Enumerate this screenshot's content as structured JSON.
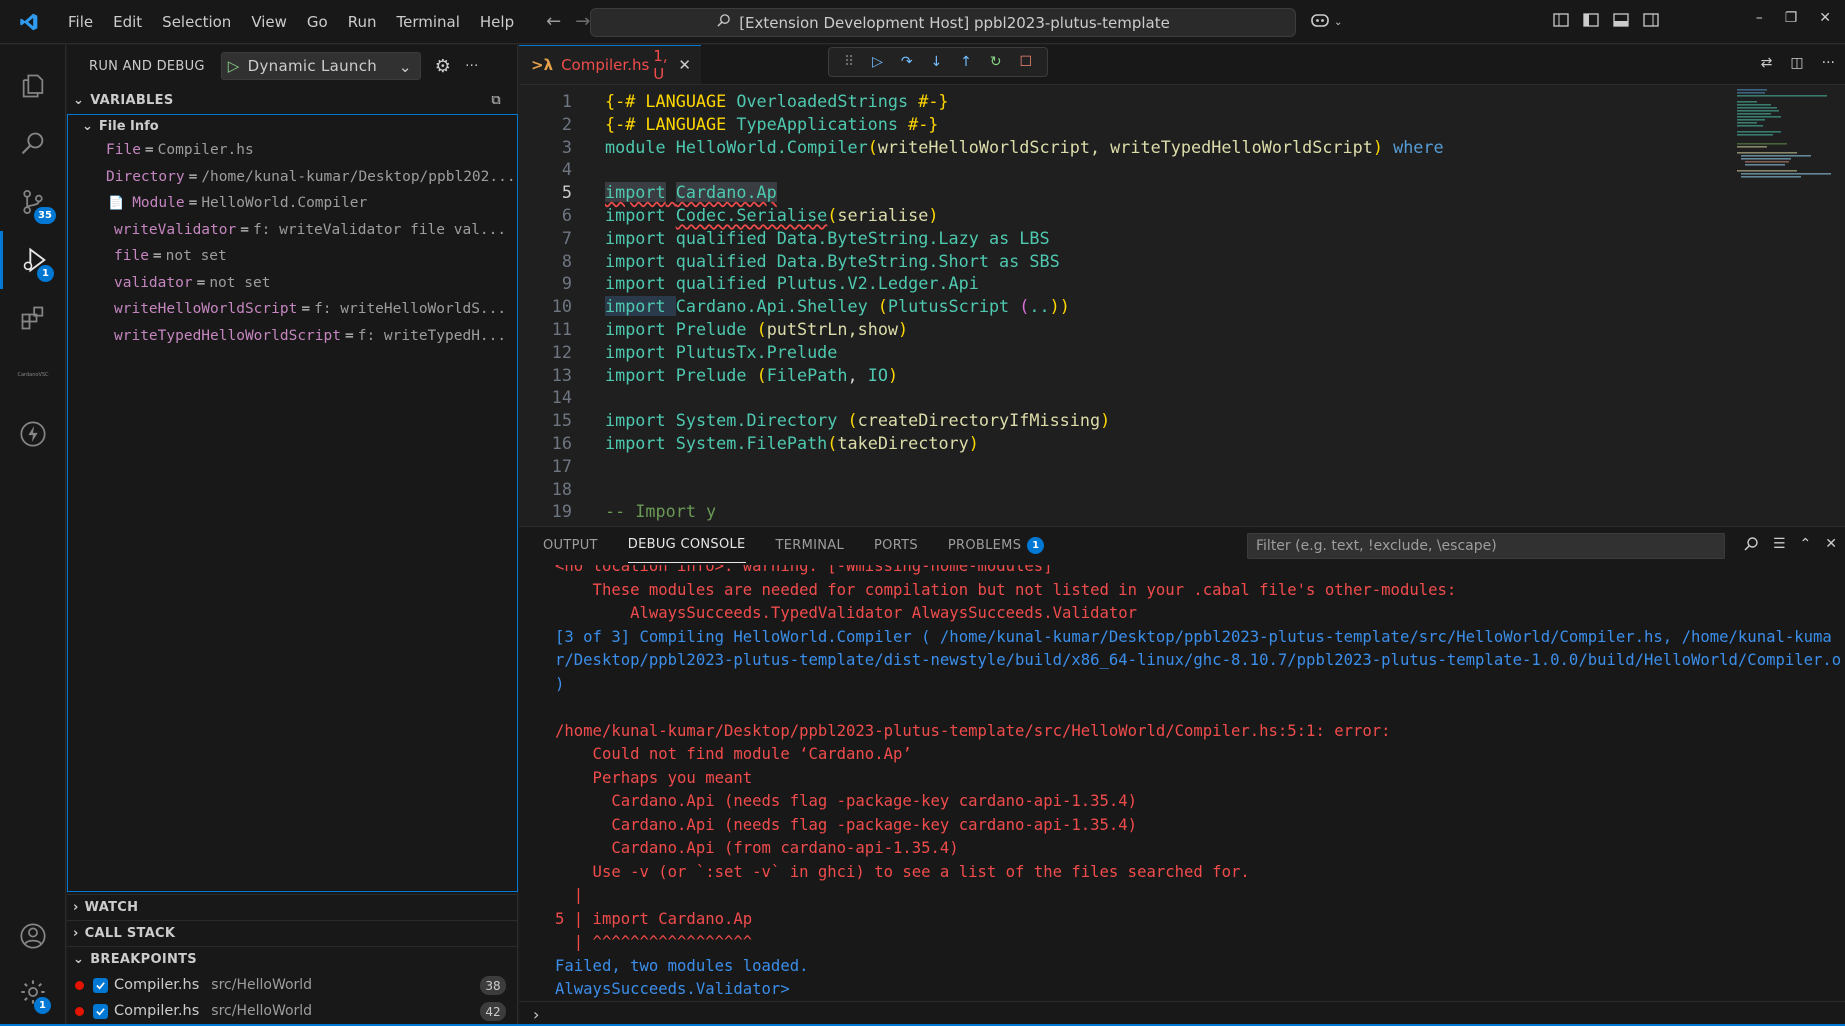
{
  "window": {
    "title": "[Extension Development Host] ppbl2023-plutus-template"
  },
  "menu": [
    "File",
    "Edit",
    "Selection",
    "View",
    "Go",
    "Run",
    "Terminal",
    "Help"
  ],
  "activity": {
    "scm_badge": "35",
    "debug_badge": "1",
    "settings_badge": "1",
    "cardano_label": "CardanoVSC"
  },
  "sidebar": {
    "title": "RUN AND DEBUG",
    "launch_config": "Dynamic Launch",
    "variables_label": "VARIABLES",
    "scope_label": "File Info",
    "variables": [
      {
        "name": "File",
        "value": "Compiler.hs"
      },
      {
        "name": "Directory",
        "value": "/home/kunal-kumar/Desktop/ppbl202..."
      },
      {
        "name": "Module",
        "value": "HelloWorld.Compiler"
      },
      {
        "name": "writeValidator ",
        "value": "f: writeValidator file val..."
      },
      {
        "name": "file ",
        "value": "not set"
      },
      {
        "name": "validator ",
        "value": "not set"
      },
      {
        "name": "writeHelloWorldScript ",
        "value": "f: writeHelloWorldS..."
      },
      {
        "name": "writeTypedHelloWorldScript ",
        "value": "f: writeTypedH..."
      }
    ],
    "watch_label": "WATCH",
    "callstack_label": "CALL STACK",
    "breakpoints_label": "BREAKPOINTS",
    "breakpoints": [
      {
        "file": "Compiler.hs",
        "path": "src/HelloWorld",
        "line": "38"
      },
      {
        "file": "Compiler.hs",
        "path": "src/HelloWorld",
        "line": "42"
      }
    ]
  },
  "editor": {
    "tab_label": "Compiler.hs",
    "tab_status": "1, U",
    "line_numbers": [
      "1",
      "2",
      "3",
      "4",
      "5",
      "6",
      "7",
      "8",
      "9",
      "10",
      "11",
      "12",
      "13",
      "14",
      "15",
      "16",
      "17",
      "18",
      "19"
    ]
  },
  "panel": {
    "tabs": [
      "OUTPUT",
      "DEBUG CONSOLE",
      "TERMINAL",
      "PORTS",
      "PROBLEMS"
    ],
    "problems_badge": "1",
    "filter_placeholder": "Filter (e.g. text, !exclude, \\escape)",
    "console_lines": [
      {
        "text": "<no location info>: warning: [-Wmissing-home-modules]",
        "color": "red"
      },
      {
        "text": "    These modules are needed for compilation but not listed in your .cabal file's other-modules:",
        "color": "red"
      },
      {
        "text": "        AlwaysSucceeds.TypedValidator AlwaysSucceeds.Validator",
        "color": "red"
      },
      {
        "text": "[3 of 3] Compiling HelloWorld.Compiler ( /home/kunal-kumar/Desktop/ppbl2023-plutus-template/src/HelloWorld/Compiler.hs, /home/kunal-kuma",
        "color": "blue"
      },
      {
        "text": "r/Desktop/ppbl2023-plutus-template/dist-newstyle/build/x86_64-linux/ghc-8.10.7/ppbl2023-plutus-template-1.0.0/build/HelloWorld/Compiler.o",
        "color": "blue"
      },
      {
        "text": ")",
        "color": "blue"
      },
      {
        "text": "",
        "color": "red"
      },
      {
        "text": "/home/kunal-kumar/Desktop/ppbl2023-plutus-template/src/HelloWorld/Compiler.hs:5:1: error:",
        "color": "red"
      },
      {
        "text": "    Could not find module ‘Cardano.Ap’",
        "color": "red"
      },
      {
        "text": "    Perhaps you meant",
        "color": "red"
      },
      {
        "text": "      Cardano.Api (needs flag -package-key cardano-api-1.35.4)",
        "color": "red"
      },
      {
        "text": "      Cardano.Api (needs flag -package-key cardano-api-1.35.4)",
        "color": "red"
      },
      {
        "text": "      Cardano.Api (from cardano-api-1.35.4)",
        "color": "red"
      },
      {
        "text": "    Use -v (or `:set -v` in ghci) to see a list of the files searched for.",
        "color": "red"
      },
      {
        "text": "  |",
        "color": "red"
      },
      {
        "text": "5 | import Cardano.Ap",
        "color": "red"
      },
      {
        "text": "  | ^^^^^^^^^^^^^^^^^",
        "color": "red"
      },
      {
        "text": "Failed, two modules loaded.",
        "color": "blue"
      },
      {
        "text": "AlwaysSucceeds.Validator>",
        "color": "blue"
      }
    ]
  },
  "code": {
    "l1": [
      "{-# LANGUAGE ",
      "OverloadedStrings",
      " #-}"
    ],
    "l2": [
      "{-# LANGUAGE ",
      "TypeApplications",
      " #-}"
    ],
    "l3": [
      "module ",
      "HelloWorld.Compiler",
      "(",
      "writeHelloWorldScript, writeTypedHelloWorldScript",
      ") ",
      "where"
    ],
    "l5": [
      "import",
      " ",
      "Cardano.Ap"
    ],
    "l6": [
      "import ",
      "Codec.Serialise",
      "(",
      "serialise",
      ")"
    ],
    "l7": [
      "import ",
      "qualified ",
      "Data.ByteString.Lazy",
      " as ",
      "LBS"
    ],
    "l8": [
      "import ",
      "qualified ",
      "Data.ByteString.Short",
      " as ",
      "SBS"
    ],
    "l9": [
      "import ",
      "qualified ",
      "Plutus.V2.Ledger.Api"
    ],
    "l10": [
      "import ",
      "Cardano.Api.Shelley",
      " (",
      "PlutusScript",
      " (",
      "..",
      "))"
    ],
    "l11": [
      "import ",
      "Prelude",
      " (",
      "putStrLn,show",
      ")"
    ],
    "l12": [
      "import ",
      "PlutusTx.Prelude"
    ],
    "l13": [
      "import ",
      "Prelude",
      " (",
      "FilePath",
      ", ",
      "IO",
      ")"
    ],
    "l15": [
      "import ",
      "System.Directory",
      " (",
      "createDirectoryIfMissing",
      ")"
    ],
    "l16": [
      "import ",
      "System.FilePath",
      "(",
      "takeDirectory",
      ")"
    ],
    "l19": [
      "-- Import y"
    ]
  }
}
